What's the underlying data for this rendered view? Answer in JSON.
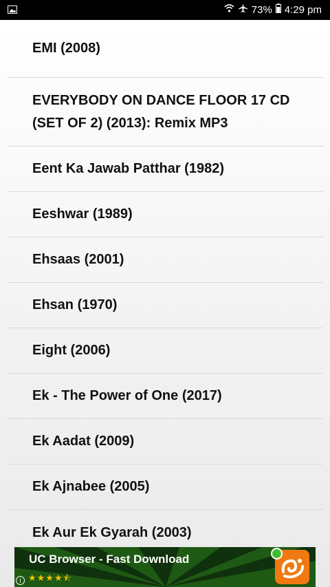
{
  "status_bar": {
    "battery": "73%",
    "time": "4:29 pm",
    "icons": [
      "image-icon",
      "wifi-icon",
      "airplane-icon",
      "battery-icon"
    ]
  },
  "list": {
    "items": [
      "EMI (2008)",
      "EVERYBODY ON DANCE FLOOR 17 CD (SET OF 2) (2013): Remix MP3",
      "Eent Ka Jawab Patthar (1982)",
      "Eeshwar (1989)",
      "Ehsaas (2001)",
      "Ehsan (1970)",
      "Eight (2006)",
      "Ek - The Power of One (2017)",
      "Ek Aadat (2009)",
      "Ek Ajnabee (2005)",
      "Ek Aur Ek Gyarah (2003)"
    ]
  },
  "ad": {
    "title": "UC Browser - Fast Download",
    "rating_stars": "★★★★⯪",
    "info_symbol": "i",
    "colors": {
      "background": "#0f2f0c",
      "logo": "#f07a11",
      "badge": "#3fbf2f"
    }
  }
}
